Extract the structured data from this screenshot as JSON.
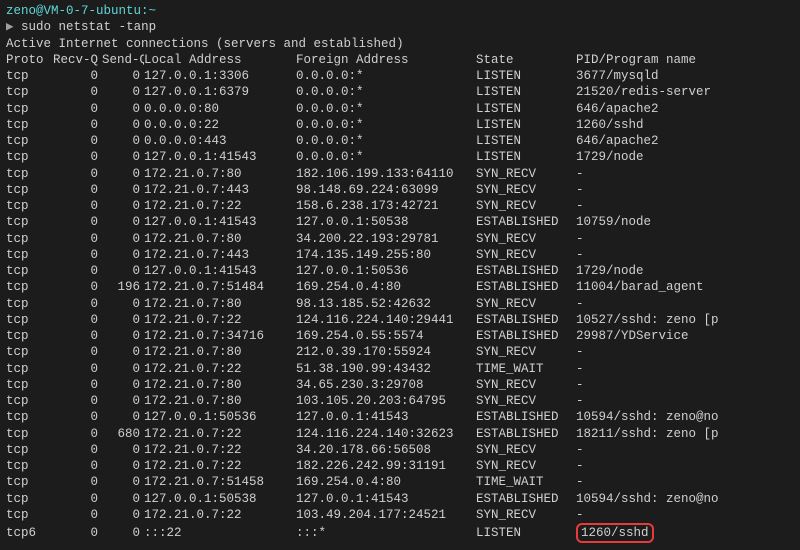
{
  "prompt": {
    "user_host": "zeno@VM-0-7-ubuntu",
    "cwd": "~",
    "symbol": "▶",
    "command": "sudo netstat -tanp"
  },
  "header_line": "Active Internet connections (servers and established)",
  "columns": {
    "proto": "Proto",
    "recvq": "Recv-Q",
    "sendq": "Send-Q",
    "local": "Local Address",
    "foreign": "Foreign Address",
    "state": "State",
    "pid": "PID/Program name"
  },
  "rows": [
    {
      "proto": "tcp",
      "recvq": "0",
      "sendq": "0",
      "local": "127.0.0.1:3306",
      "foreign": "0.0.0.0:*",
      "state": "LISTEN",
      "pid": "3677/mysqld"
    },
    {
      "proto": "tcp",
      "recvq": "0",
      "sendq": "0",
      "local": "127.0.0.1:6379",
      "foreign": "0.0.0.0:*",
      "state": "LISTEN",
      "pid": "21520/redis-server"
    },
    {
      "proto": "tcp",
      "recvq": "0",
      "sendq": "0",
      "local": "0.0.0.0:80",
      "foreign": "0.0.0.0:*",
      "state": "LISTEN",
      "pid": "646/apache2"
    },
    {
      "proto": "tcp",
      "recvq": "0",
      "sendq": "0",
      "local": "0.0.0.0:22",
      "foreign": "0.0.0.0:*",
      "state": "LISTEN",
      "pid": "1260/sshd"
    },
    {
      "proto": "tcp",
      "recvq": "0",
      "sendq": "0",
      "local": "0.0.0.0:443",
      "foreign": "0.0.0.0:*",
      "state": "LISTEN",
      "pid": "646/apache2"
    },
    {
      "proto": "tcp",
      "recvq": "0",
      "sendq": "0",
      "local": "127.0.0.1:41543",
      "foreign": "0.0.0.0:*",
      "state": "LISTEN",
      "pid": "1729/node"
    },
    {
      "proto": "tcp",
      "recvq": "0",
      "sendq": "0",
      "local": "172.21.0.7:80",
      "foreign": "182.106.199.133:64110",
      "state": "SYN_RECV",
      "pid": "-"
    },
    {
      "proto": "tcp",
      "recvq": "0",
      "sendq": "0",
      "local": "172.21.0.7:443",
      "foreign": "98.148.69.224:63099",
      "state": "SYN_RECV",
      "pid": "-"
    },
    {
      "proto": "tcp",
      "recvq": "0",
      "sendq": "0",
      "local": "172.21.0.7:22",
      "foreign": "158.6.238.173:42721",
      "state": "SYN_RECV",
      "pid": "-"
    },
    {
      "proto": "tcp",
      "recvq": "0",
      "sendq": "0",
      "local": "127.0.0.1:41543",
      "foreign": "127.0.0.1:50538",
      "state": "ESTABLISHED",
      "pid": "10759/node"
    },
    {
      "proto": "tcp",
      "recvq": "0",
      "sendq": "0",
      "local": "172.21.0.7:80",
      "foreign": "34.200.22.193:29781",
      "state": "SYN_RECV",
      "pid": "-"
    },
    {
      "proto": "tcp",
      "recvq": "0",
      "sendq": "0",
      "local": "172.21.0.7:443",
      "foreign": "174.135.149.255:80",
      "state": "SYN_RECV",
      "pid": "-"
    },
    {
      "proto": "tcp",
      "recvq": "0",
      "sendq": "0",
      "local": "127.0.0.1:41543",
      "foreign": "127.0.0.1:50536",
      "state": "ESTABLISHED",
      "pid": "1729/node"
    },
    {
      "proto": "tcp",
      "recvq": "0",
      "sendq": "196",
      "local": "172.21.0.7:51484",
      "foreign": "169.254.0.4:80",
      "state": "ESTABLISHED",
      "pid": "11004/barad_agent"
    },
    {
      "proto": "tcp",
      "recvq": "0",
      "sendq": "0",
      "local": "172.21.0.7:80",
      "foreign": "98.13.185.52:42632",
      "state": "SYN_RECV",
      "pid": "-"
    },
    {
      "proto": "tcp",
      "recvq": "0",
      "sendq": "0",
      "local": "172.21.0.7:22",
      "foreign": "124.116.224.140:29441",
      "state": "ESTABLISHED",
      "pid": "10527/sshd: zeno [p"
    },
    {
      "proto": "tcp",
      "recvq": "0",
      "sendq": "0",
      "local": "172.21.0.7:34716",
      "foreign": "169.254.0.55:5574",
      "state": "ESTABLISHED",
      "pid": "29987/YDService"
    },
    {
      "proto": "tcp",
      "recvq": "0",
      "sendq": "0",
      "local": "172.21.0.7:80",
      "foreign": "212.0.39.170:55924",
      "state": "SYN_RECV",
      "pid": "-"
    },
    {
      "proto": "tcp",
      "recvq": "0",
      "sendq": "0",
      "local": "172.21.0.7:22",
      "foreign": "51.38.190.99:43432",
      "state": "TIME_WAIT",
      "pid": "-"
    },
    {
      "proto": "tcp",
      "recvq": "0",
      "sendq": "0",
      "local": "172.21.0.7:80",
      "foreign": "34.65.230.3:29708",
      "state": "SYN_RECV",
      "pid": "-"
    },
    {
      "proto": "tcp",
      "recvq": "0",
      "sendq": "0",
      "local": "172.21.0.7:80",
      "foreign": "103.105.20.203:64795",
      "state": "SYN_RECV",
      "pid": "-"
    },
    {
      "proto": "tcp",
      "recvq": "0",
      "sendq": "0",
      "local": "127.0.0.1:50536",
      "foreign": "127.0.0.1:41543",
      "state": "ESTABLISHED",
      "pid": "10594/sshd: zeno@no"
    },
    {
      "proto": "tcp",
      "recvq": "0",
      "sendq": "680",
      "local": "172.21.0.7:22",
      "foreign": "124.116.224.140:32623",
      "state": "ESTABLISHED",
      "pid": "18211/sshd: zeno [p"
    },
    {
      "proto": "tcp",
      "recvq": "0",
      "sendq": "0",
      "local": "172.21.0.7:22",
      "foreign": "34.20.178.66:56508",
      "state": "SYN_RECV",
      "pid": "-"
    },
    {
      "proto": "tcp",
      "recvq": "0",
      "sendq": "0",
      "local": "172.21.0.7:22",
      "foreign": "182.226.242.99:31191",
      "state": "SYN_RECV",
      "pid": "-"
    },
    {
      "proto": "tcp",
      "recvq": "0",
      "sendq": "0",
      "local": "172.21.0.7:51458",
      "foreign": "169.254.0.4:80",
      "state": "TIME_WAIT",
      "pid": "-"
    },
    {
      "proto": "tcp",
      "recvq": "0",
      "sendq": "0",
      "local": "127.0.0.1:50538",
      "foreign": "127.0.0.1:41543",
      "state": "ESTABLISHED",
      "pid": "10594/sshd: zeno@no"
    },
    {
      "proto": "tcp",
      "recvq": "0",
      "sendq": "0",
      "local": "172.21.0.7:22",
      "foreign": "103.49.204.177:24521",
      "state": "SYN_RECV",
      "pid": "-"
    },
    {
      "proto": "tcp6",
      "recvq": "0",
      "sendq": "0",
      "local": ":::22",
      "foreign": ":::*",
      "state": "LISTEN",
      "pid": "1260/sshd",
      "highlight": true
    }
  ]
}
